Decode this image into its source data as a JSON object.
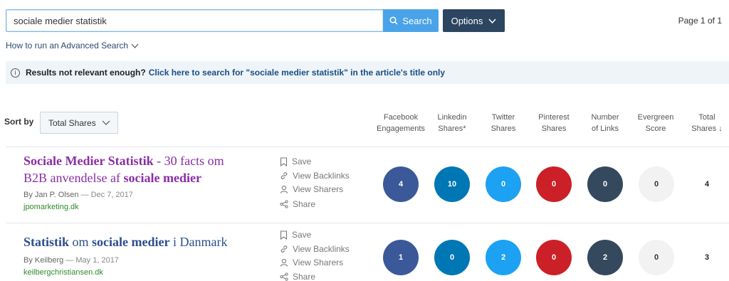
{
  "search": {
    "value": "sociale medier statistik",
    "button_label": "Search"
  },
  "options_label": "Options",
  "pagination": "Page 1 of 1",
  "advanced_link": "How to run an Advanced Search",
  "notice": {
    "lead": "Results not relevant enough?",
    "link": "Click here to search for \"sociale medier statistik\" in the article's title only"
  },
  "sort": {
    "label": "Sort by",
    "selected": "Total Shares"
  },
  "columns": {
    "facebook": [
      "Facebook",
      "Engagements"
    ],
    "linkedin": [
      "Linkedin",
      "Shares*"
    ],
    "twitter": [
      "Twitter",
      "Shares"
    ],
    "pinterest": [
      "Pinterest",
      "Shares"
    ],
    "links": [
      "Number",
      "of Links"
    ],
    "evergreen": [
      "Evergreen",
      "Score"
    ],
    "total": [
      "Total",
      "Shares ↓"
    ]
  },
  "actions": {
    "save": "Save",
    "backlinks": "View Backlinks",
    "sharers": "View Sharers",
    "share": "Share"
  },
  "colors": {
    "facebook": "#3b5998",
    "linkedin": "#0077b5",
    "twitter": "#1da1f2",
    "pinterest": "#cb2027",
    "links": "#34495e",
    "evergreen": "#f2f2f2",
    "title_visited": "#8a2ea5",
    "title_default": "#2b4f8c",
    "domain": "#2e8b2e"
  },
  "results": [
    {
      "title_parts": [
        "Sociale Medier Statistik",
        " - 30 facts om",
        "B2B anvendelse af ",
        "sociale medier"
      ],
      "author": "By Jan P. Olsen",
      "date": "Dec 7, 2017",
      "domain": "jpomarketing.dk",
      "facebook": "4",
      "linkedin": "10",
      "twitter": "0",
      "pinterest": "0",
      "links": "0",
      "evergreen": "0",
      "total": "4"
    },
    {
      "title_parts": [
        "Statistik",
        " om ",
        "sociale medier",
        " i Danmark"
      ],
      "author": "By Keilberg",
      "date": "May 1, 2017",
      "domain": "keilbergchristiansen.dk",
      "facebook": "1",
      "linkedin": "0",
      "twitter": "2",
      "pinterest": "0",
      "links": "2",
      "evergreen": "0",
      "total": "3"
    }
  ]
}
